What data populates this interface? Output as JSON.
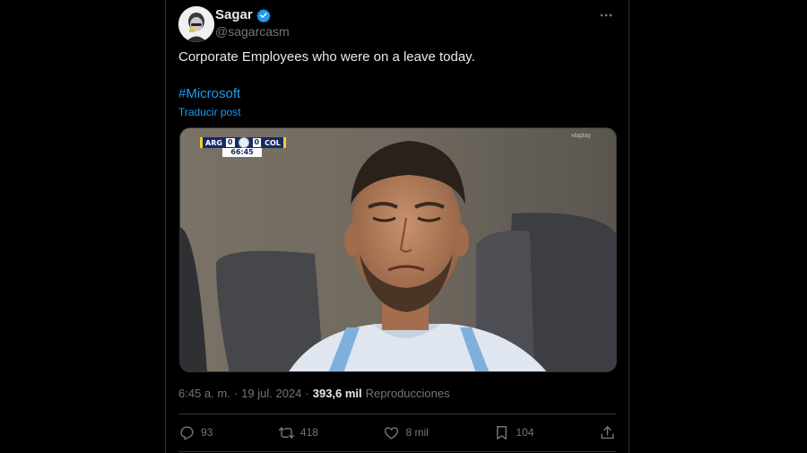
{
  "author": {
    "display_name": "Sagar",
    "handle": "@sagarcasm",
    "verified_color": "#1d9bf0"
  },
  "tweet": {
    "text": "Corporate Employees who were on a leave today.",
    "hashtag": "#Microsoft",
    "translate_label": "Traducir post"
  },
  "media": {
    "scoreboard": {
      "home_team": "ARG",
      "home_score": "0",
      "away_team": "COL",
      "away_score": "0",
      "clock": "66:45"
    },
    "watermark": "vlaplay"
  },
  "meta": {
    "time": "6:45 a. m.",
    "separator": "·",
    "date": "19 jul. 2024",
    "views": "393,6 mil",
    "views_label": "Reproducciones"
  },
  "actions": {
    "replies": "93",
    "reposts": "418",
    "likes": "8 mil",
    "bookmarks": "104"
  },
  "colors": {
    "background": "#000000",
    "link": "#1d9bf0",
    "muted": "#71767b",
    "border": "#2f3336"
  },
  "icons": [
    "verified-badge-icon",
    "more-icon",
    "reply-icon",
    "repost-icon",
    "like-icon",
    "bookmark-icon",
    "share-icon"
  ]
}
